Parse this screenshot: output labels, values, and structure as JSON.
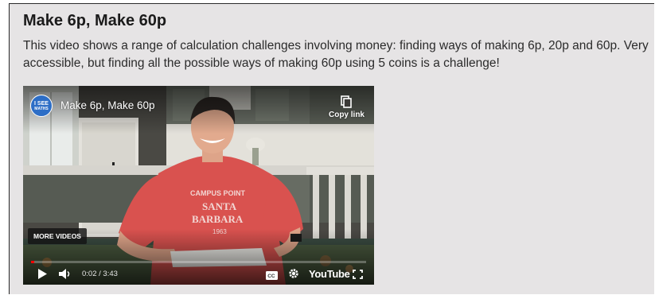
{
  "section": {
    "title": "Make 6p, Make 60p",
    "description": "This video shows a range of calculation challenges involving money: finding ways of making 6p, 20p and 60p. Very accessible, but finding all the possible ways of making 60p using 5 coins is a challenge!"
  },
  "video": {
    "channel_logo_text_1": "I SEE",
    "channel_logo_text_2": "MATHS",
    "title": "Make 6p, Make 60p",
    "copy_link_label": "Copy link",
    "more_videos_label": "MORE VIDEOS",
    "time_display": "0:02 / 3:43",
    "progress_fraction": 0.009,
    "youtube_label": "YouTube",
    "shirt_text_1": "CAMPUS POINT",
    "shirt_text_2": "SANTA",
    "shirt_text_3": "BARBARA",
    "shirt_text_4": "1963",
    "icons": [
      "copy-icon",
      "play-icon",
      "volume-icon",
      "cc-icon",
      "settings-icon",
      "fullscreen-icon"
    ]
  },
  "colors": {
    "card_background": "#e6e4e5",
    "progress_red": "#ff0000",
    "shirt_red": "#d9524f",
    "channel_blue": "#2d6ec6"
  }
}
